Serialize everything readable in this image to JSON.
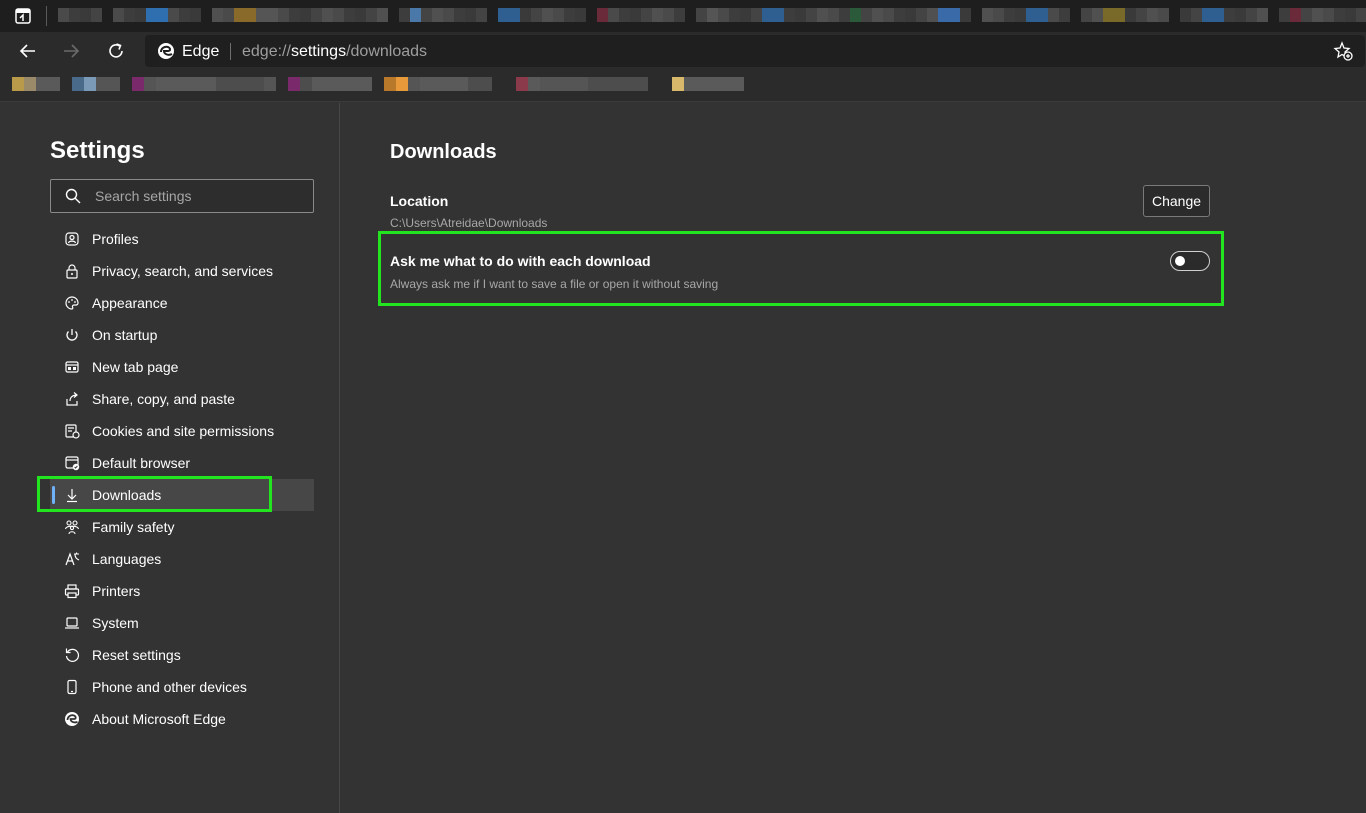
{
  "browser": {
    "brand": "Edge",
    "url_prefix": "edge://",
    "url_highlight": "settings",
    "url_suffix": "/downloads"
  },
  "sidebar": {
    "title": "Settings",
    "search_placeholder": "Search settings",
    "items": [
      {
        "label": "Profiles",
        "icon": "profile-icon"
      },
      {
        "label": "Privacy, search, and services",
        "icon": "lock-icon"
      },
      {
        "label": "Appearance",
        "icon": "palette-icon"
      },
      {
        "label": "On startup",
        "icon": "power-icon"
      },
      {
        "label": "New tab page",
        "icon": "new-tab-icon"
      },
      {
        "label": "Share, copy, and paste",
        "icon": "share-icon"
      },
      {
        "label": "Cookies and site permissions",
        "icon": "cookies-icon"
      },
      {
        "label": "Default browser",
        "icon": "default-browser-icon"
      },
      {
        "label": "Downloads",
        "icon": "download-icon",
        "active": true
      },
      {
        "label": "Family safety",
        "icon": "family-icon"
      },
      {
        "label": "Languages",
        "icon": "languages-icon"
      },
      {
        "label": "Printers",
        "icon": "printer-icon"
      },
      {
        "label": "System",
        "icon": "laptop-icon"
      },
      {
        "label": "Reset settings",
        "icon": "reset-icon"
      },
      {
        "label": "Phone and other devices",
        "icon": "phone-icon"
      },
      {
        "label": "About Microsoft Edge",
        "icon": "edge-logo-icon"
      }
    ]
  },
  "main": {
    "title": "Downloads",
    "location_label": "Location",
    "location_path": "C:\\Users\\Atreidae\\Downloads",
    "change_button": "Change",
    "ask_title": "Ask me what to do with each download",
    "ask_description": "Always ask me if I want to save a file or open it without saving",
    "ask_enabled": false
  },
  "colors": {
    "highlight": "#22e41f",
    "accent": "#6fb2f7",
    "background": "#333333"
  }
}
